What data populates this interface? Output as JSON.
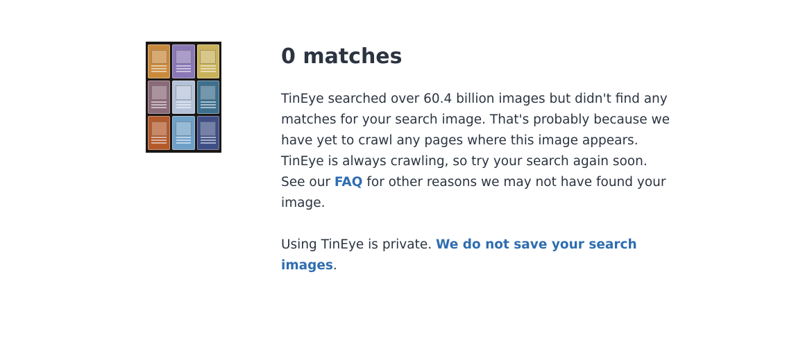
{
  "result": {
    "title": "0 matches",
    "description_before_link": "TinEye searched over 60.4 billion images but didn't find any matches for your search image. That's probably because we have yet to crawl any pages where this image appears. TinEye is always crawling, so try your search again soon. See our ",
    "faq_link": "FAQ",
    "description_after_link": " for other reasons we may not have found your image.",
    "privacy_text": "Using TinEye is private. ",
    "privacy_link": "We do not save your search images",
    "privacy_end": "."
  },
  "search_image": {
    "card_colors": [
      "#c98a3c",
      "#8a78b6",
      "#c9b25a",
      "#8a6a78",
      "#b4c2d8",
      "#3d6f8e",
      "#b35a2c",
      "#6fa0c8",
      "#3f4f86"
    ]
  },
  "colors": {
    "text": "#2b3440",
    "link": "#2f6db0"
  }
}
